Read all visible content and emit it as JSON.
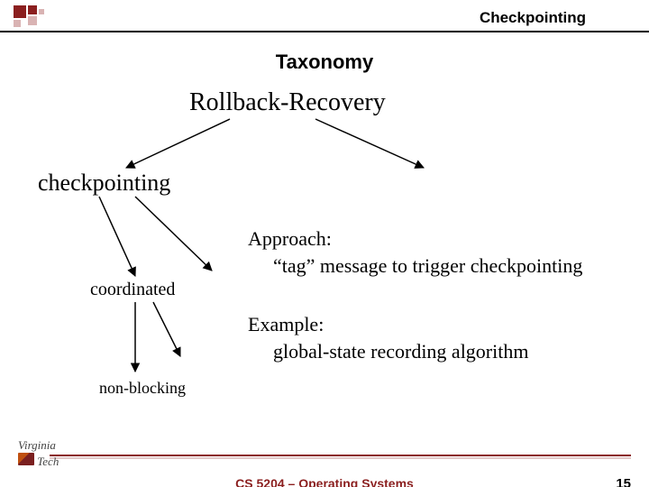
{
  "header": {
    "running_title": "Checkpointing"
  },
  "title": "Taxonomy",
  "tree": {
    "root": "Rollback-Recovery",
    "level1": "checkpointing",
    "level2": "coordinated",
    "level3": "non-blocking"
  },
  "body": {
    "approach_label": "Approach:",
    "approach_text": "“tag” message to trigger checkpointing",
    "example_label": "Example:",
    "example_text": "global-state recording algorithm"
  },
  "footer": {
    "course": "CS 5204 – Operating Systems",
    "page": "15",
    "logo_top": "Virginia",
    "logo_bottom": "Tech"
  },
  "colors": {
    "accent": "#8b1f1f"
  }
}
